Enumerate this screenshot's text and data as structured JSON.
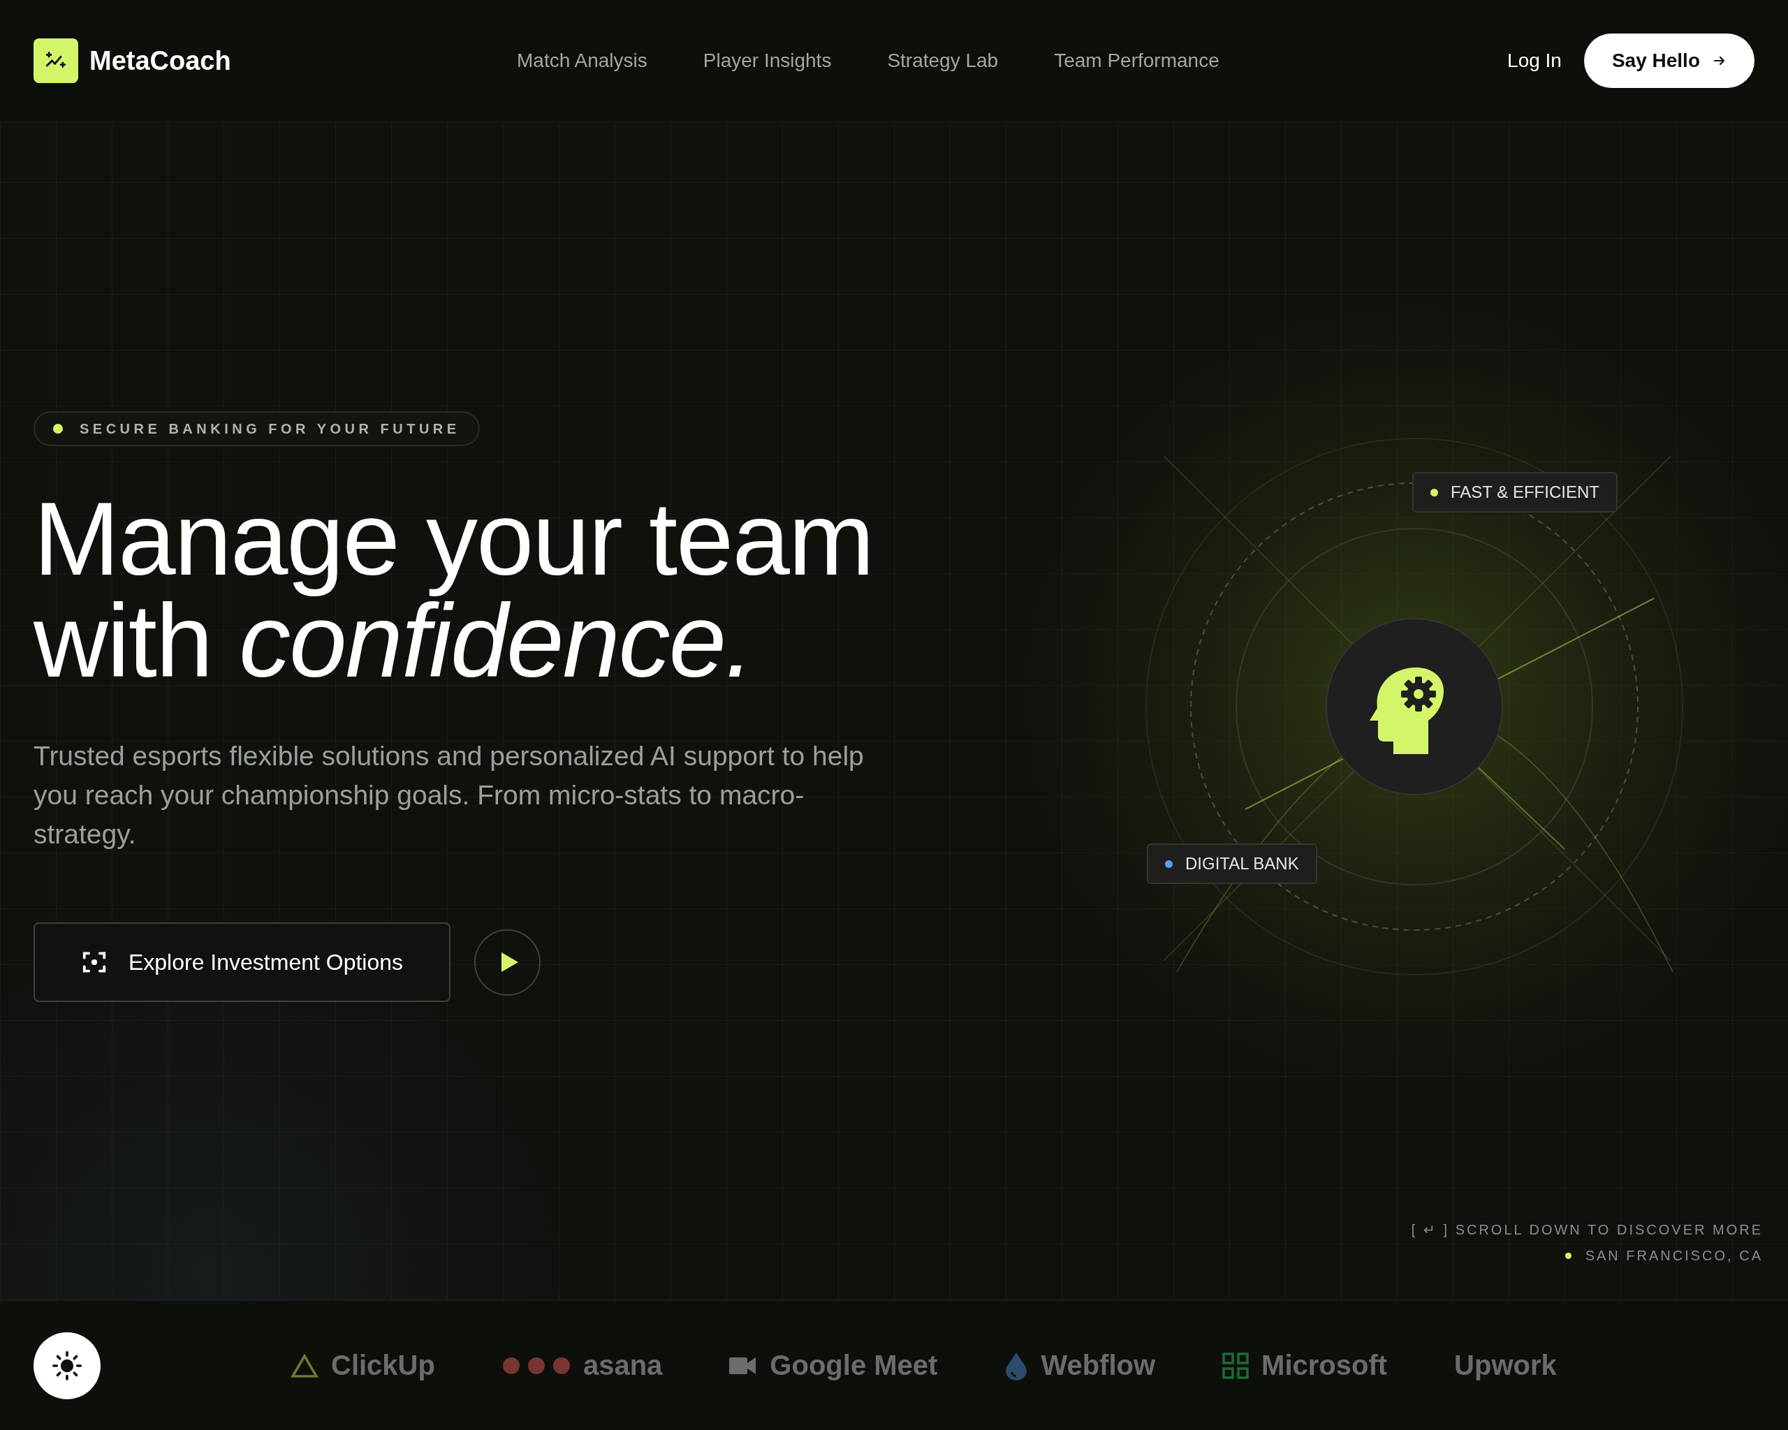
{
  "header": {
    "brand": "MetaCoach",
    "nav": [
      {
        "label": "Match Analysis"
      },
      {
        "label": "Player Insights"
      },
      {
        "label": "Strategy Lab"
      },
      {
        "label": "Team Performance"
      }
    ],
    "login": "Log In",
    "cta": "Say Hello"
  },
  "hero": {
    "badge": "SECURE BANKING FOR YOUR FUTURE",
    "headline": "Manage your team with *confidence.*",
    "text": "Trusted esports flexible solutions and personalized AI support to help you reach your championship goals. From micro-stats to macro-strategy.",
    "primary_button": "Explore Investment Options",
    "tags": [
      {
        "label": "FAST & EFFICIENT",
        "color": "#d4f56a"
      },
      {
        "label": "DIGITAL BANK",
        "color": "#5b9cf5"
      }
    ],
    "scroll_hint": "[ ↵ ] SCROLL DOWN TO DISCOVER MORE",
    "location": "SAN FRANCISCO, CA"
  },
  "logos": [
    {
      "kind": "triangle",
      "name": "ClickUp"
    },
    {
      "kind": "dots",
      "name": "asana"
    },
    {
      "kind": "camera",
      "name": "Google Meet"
    },
    {
      "kind": "drop",
      "name": "Webflow"
    },
    {
      "kind": "grid",
      "name": "Microsoft"
    },
    {
      "kind": "text",
      "name": "Upwork"
    }
  ]
}
